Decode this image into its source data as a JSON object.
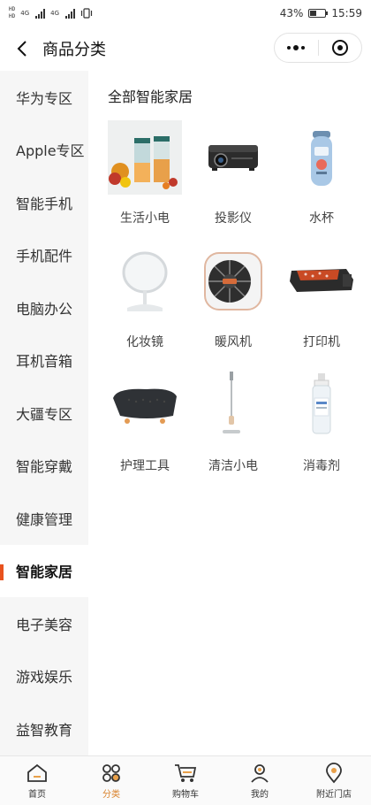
{
  "status_bar": {
    "hd_top": "HD",
    "hd_bottom": "HD",
    "net1": "4G",
    "net2": "4G",
    "battery_percent": "43%",
    "battery_level": 0.43,
    "time": "15:59"
  },
  "nav": {
    "title": "商品分类",
    "back_icon": "chevron-left-icon",
    "more_icon": "more-dots-icon",
    "close_icon": "target-circle-icon"
  },
  "sidebar": {
    "items": [
      {
        "label": "华为专区"
      },
      {
        "label": "Apple专区"
      },
      {
        "label": "智能手机"
      },
      {
        "label": "手机配件"
      },
      {
        "label": "电脑办公"
      },
      {
        "label": "耳机音箱"
      },
      {
        "label": "大疆专区"
      },
      {
        "label": "智能穿戴"
      },
      {
        "label": "健康管理"
      },
      {
        "label": "智能家居",
        "active": true
      },
      {
        "label": "电子美容"
      },
      {
        "label": "游戏娱乐"
      },
      {
        "label": "益智教育"
      }
    ],
    "accent_color": "#e8521e"
  },
  "content": {
    "section_title": "全部智能家居",
    "products": [
      {
        "name": "生活小电",
        "icon": "blender-image"
      },
      {
        "name": "投影仪",
        "icon": "projector-image"
      },
      {
        "name": "水杯",
        "icon": "water-cup-image"
      },
      {
        "name": "化妆镜",
        "icon": "makeup-mirror-image"
      },
      {
        "name": "暖风机",
        "icon": "heater-image"
      },
      {
        "name": "打印机",
        "icon": "printer-image"
      },
      {
        "name": "护理工具",
        "icon": "care-tool-image"
      },
      {
        "name": "清洁小电",
        "icon": "steam-mop-image"
      },
      {
        "name": "消毒剂",
        "icon": "disinfectant-bottle-image"
      }
    ]
  },
  "tab_bar": {
    "tabs": [
      {
        "label": "首页",
        "icon": "home-icon"
      },
      {
        "label": "分类",
        "icon": "category-grid-icon",
        "active": true
      },
      {
        "label": "购物车",
        "icon": "cart-icon"
      },
      {
        "label": "我的",
        "icon": "user-icon"
      },
      {
        "label": "附近门店",
        "icon": "location-pin-icon"
      }
    ],
    "active_color": "#d9822b"
  }
}
